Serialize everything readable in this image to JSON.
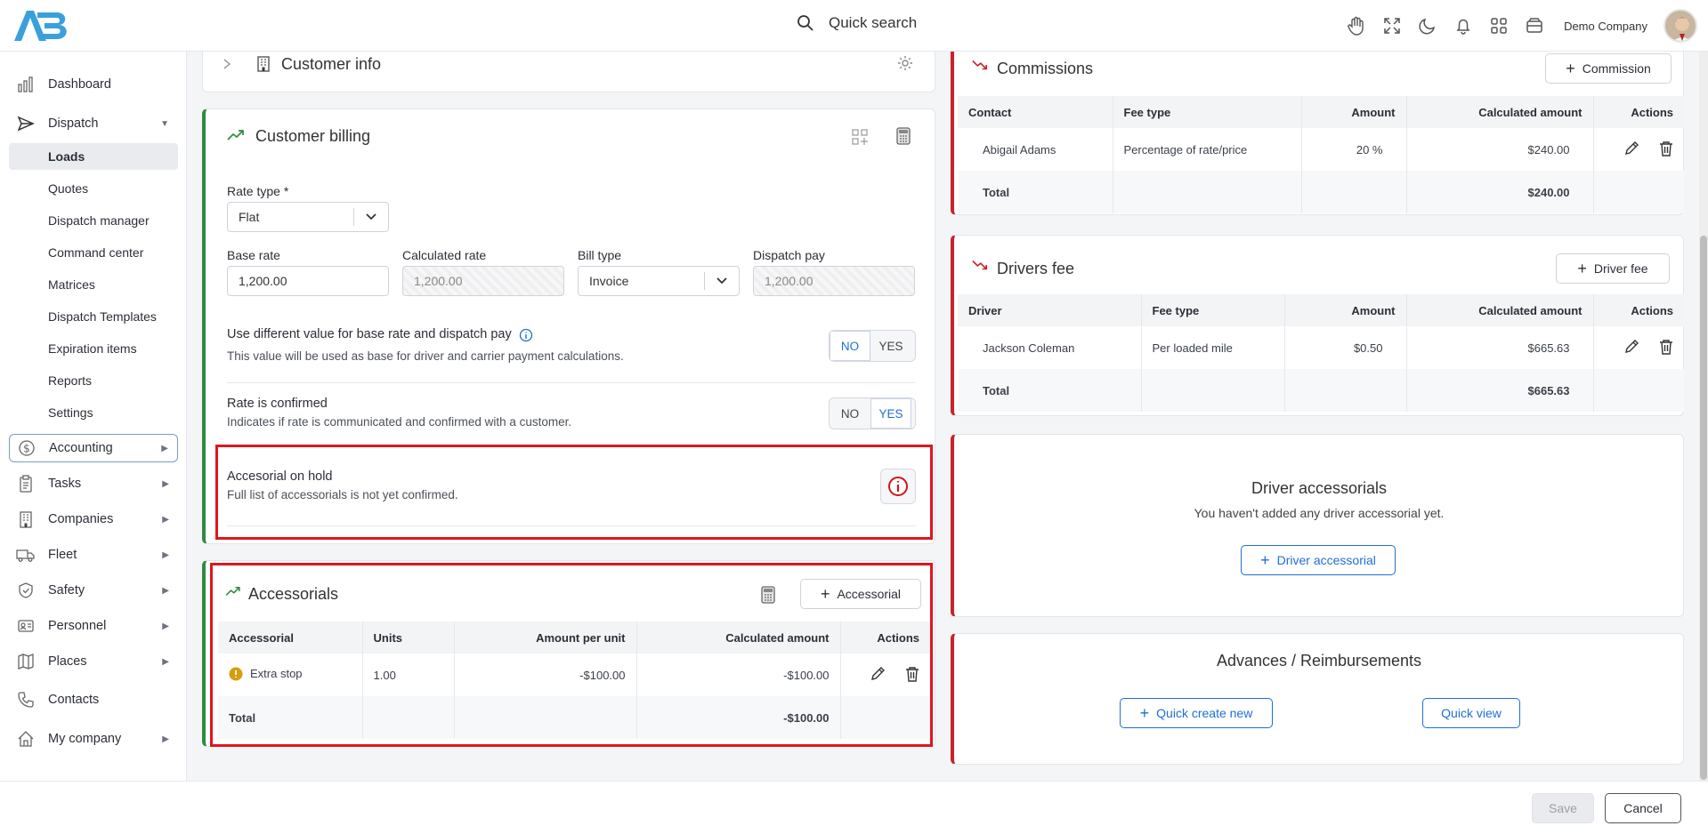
{
  "colors": {
    "accent": "#1f6fd1",
    "success": "#2e8b3e",
    "danger": "#c8232a",
    "highlight_box": "#e0161e"
  },
  "header": {
    "search_label": "Quick search",
    "company": "Demo Company"
  },
  "sidebar": {
    "items": [
      {
        "label": "Dashboard",
        "icon": "chart-bars-icon"
      },
      {
        "label": "Dispatch",
        "icon": "send-icon"
      },
      {
        "label": "Accounting",
        "icon": "dollar-circle-icon"
      },
      {
        "label": "Tasks",
        "icon": "clipboard-icon"
      },
      {
        "label": "Companies",
        "icon": "building-icon"
      },
      {
        "label": "Fleet",
        "icon": "truck-icon"
      },
      {
        "label": "Safety",
        "icon": "shield-icon"
      },
      {
        "label": "Personnel",
        "icon": "id-card-icon"
      },
      {
        "label": "Places",
        "icon": "map-icon"
      },
      {
        "label": "Contacts",
        "icon": "phone-icon"
      },
      {
        "label": "My company",
        "icon": "home-icon"
      }
    ],
    "dispatch_sub": [
      "Loads",
      "Quotes",
      "Dispatch manager",
      "Command center",
      "Matrices",
      "Dispatch Templates",
      "Expiration items",
      "Reports",
      "Settings"
    ]
  },
  "customer_info": {
    "title": "Customer info"
  },
  "billing": {
    "title": "Customer billing",
    "rate_type_label": "Rate type *",
    "rate_type_value": "Flat",
    "base_rate_label": "Base rate",
    "base_rate_value": "1,200.00",
    "calc_rate_label": "Calculated rate",
    "calc_rate_value": "1,200.00",
    "bill_type_label": "Bill type",
    "bill_type_value": "Invoice",
    "dispatch_pay_label": "Dispatch pay",
    "dispatch_pay_value": "1,200.00",
    "diff_value_title": "Use different value for base rate and dispatch pay",
    "diff_value_desc": "This value will be used as base for driver and carrier payment calculations.",
    "rate_confirmed_title": "Rate is confirmed",
    "rate_confirmed_desc": "Indicates if rate is communicated and confirmed with a customer.",
    "accessorial_hold_title": "Accesorial on hold",
    "accessorial_hold_desc": "Full list of accessorials is not yet confirmed.",
    "no": "NO",
    "yes": "YES"
  },
  "accessorials": {
    "title": "Accessorials",
    "add_label": "Accessorial",
    "headers": [
      "Accessorial",
      "Units",
      "Amount per unit",
      "Calculated amount",
      "Actions"
    ],
    "row": {
      "name": "Extra stop",
      "units": "1.00",
      "per_unit": "-$100.00",
      "calc": "-$100.00"
    },
    "total_label": "Total",
    "total_value": "-$100.00"
  },
  "commissions": {
    "title": "Commissions",
    "add_label": "Commission",
    "headers": [
      "Contact",
      "Fee type",
      "Amount",
      "Calculated amount",
      "Actions"
    ],
    "row": {
      "contact": "Abigail Adams",
      "fee_type": "Percentage of rate/price",
      "amount": "20 %",
      "calc": "$240.00"
    },
    "total_label": "Total",
    "total_value": "$240.00"
  },
  "drivers_fee": {
    "title": "Drivers fee",
    "add_label": "Driver fee",
    "headers": [
      "Driver",
      "Fee type",
      "Amount",
      "Calculated amount",
      "Actions"
    ],
    "row": {
      "driver": "Jackson Coleman",
      "fee_type": "Per loaded mile",
      "amount": "$0.50",
      "calc": "$665.63"
    },
    "total_label": "Total",
    "total_value": "$665.63"
  },
  "driver_accessorials": {
    "title": "Driver accessorials",
    "empty": "You haven't added any driver accessorial yet.",
    "add_label": "Driver accessorial"
  },
  "advances": {
    "title": "Advances / Reimbursements",
    "quick_create": "Quick create new",
    "quick_view": "Quick view"
  },
  "footer": {
    "save": "Save",
    "cancel": "Cancel"
  }
}
